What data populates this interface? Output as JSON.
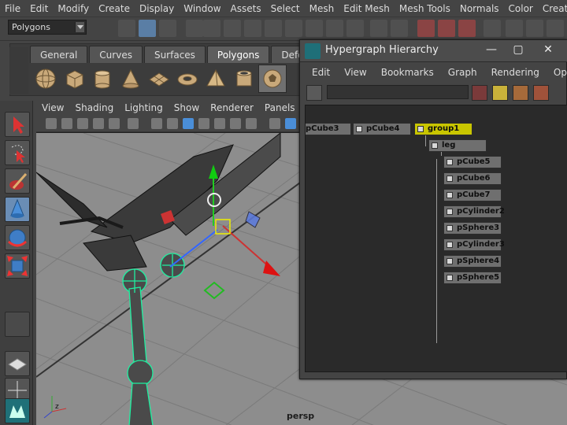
{
  "menubar": {
    "items": [
      "File",
      "Edit",
      "Modify",
      "Create",
      "Display",
      "Window",
      "Assets",
      "Select",
      "Mesh",
      "Edit Mesh",
      "Mesh Tools",
      "Normals",
      "Color",
      "Create UVs"
    ]
  },
  "statusline": {
    "mode": "Polygons"
  },
  "shelf": {
    "tabs": [
      "General",
      "Curves",
      "Surfaces",
      "Polygons",
      "Deformatio"
    ],
    "active_tab": "Polygons",
    "icons": [
      "sphere-icon",
      "cube-icon",
      "cylinder-icon",
      "cone-icon",
      "plane-icon",
      "torus-icon",
      "pyramid-icon",
      "pipe-icon",
      "soccer-ball-icon"
    ]
  },
  "viewport": {
    "menu": [
      "View",
      "Shading",
      "Lighting",
      "Show",
      "Renderer",
      "Panels"
    ],
    "camera_label": "persp"
  },
  "hypergraph": {
    "title": "Hypergraph Hierarchy",
    "menu": [
      "Edit",
      "View",
      "Bookmarks",
      "Graph",
      "Rendering",
      "Options"
    ],
    "nodes": {
      "top_level": [
        "pCube3",
        "pCube4",
        "group1"
      ],
      "leg": "leg",
      "children": [
        "pCube5",
        "pCube6",
        "pCube7",
        "pCylinder2",
        "pSphere3",
        "pCylinder3",
        "pSphere4",
        "pSphere5"
      ]
    },
    "selected": "group1"
  },
  "colors": {
    "selected_node": "#c9c600",
    "node": "#6f6f6f",
    "viewport_bg": "#8d8d8d",
    "active_tool": "#6a8db5"
  }
}
